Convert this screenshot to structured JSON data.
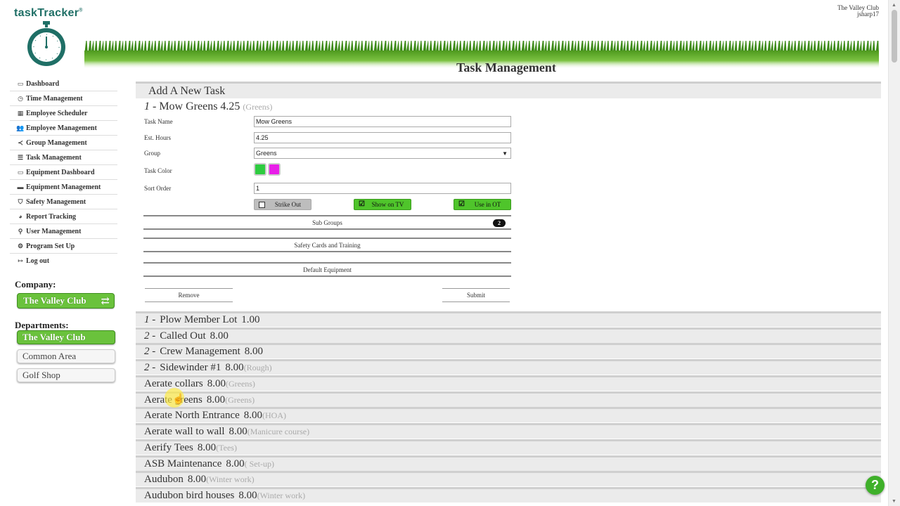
{
  "app": {
    "logo": "taskTracker",
    "logo_mark": "®"
  },
  "user": {
    "company": "The Valley Club",
    "username": "jsharp17"
  },
  "page_title": "Task Management",
  "nav": [
    {
      "label": "Dashboard",
      "icon": "monitor-icon",
      "glyph": "▭"
    },
    {
      "label": "Time Management",
      "icon": "clock-icon",
      "glyph": "◷"
    },
    {
      "label": "Employee Scheduler",
      "icon": "calendar-icon",
      "glyph": "▦"
    },
    {
      "label": "Employee Management",
      "icon": "users-icon",
      "glyph": "👥"
    },
    {
      "label": "Group Management",
      "icon": "share-icon",
      "glyph": "≺"
    },
    {
      "label": "Task Management",
      "icon": "list-icon",
      "glyph": "☰"
    },
    {
      "label": "Equipment Dashboard",
      "icon": "monitor-icon",
      "glyph": "▭"
    },
    {
      "label": "Equipment Management",
      "icon": "truck-icon",
      "glyph": "▬"
    },
    {
      "label": "Safety Management",
      "icon": "shield-icon",
      "glyph": "⛉"
    },
    {
      "label": "Report Tracking",
      "icon": "pie-chart-icon",
      "glyph": "◕"
    },
    {
      "label": "User Management",
      "icon": "user-plus-icon",
      "glyph": "⚲"
    },
    {
      "label": "Program Set Up",
      "icon": "gear-icon",
      "glyph": "⚙"
    },
    {
      "label": "Log out",
      "icon": "sign-out-icon",
      "glyph": "↦"
    }
  ],
  "company_section": {
    "label": "Company:",
    "button": "The Valley Club",
    "switch_glyph": "⇄"
  },
  "departments_section": {
    "label": "Departments:",
    "items": [
      "The Valley Club",
      "Common Area",
      "Golf Shop"
    ],
    "active_index": 0
  },
  "add_task_label": "Add A New Task",
  "editing_task": {
    "num": "1 -",
    "name": "Mow Greens",
    "hours": "4.25",
    "group": "(Greens)"
  },
  "form": {
    "task_name_label": "Task Name",
    "task_name_value": "Mow Greens",
    "est_hours_label": "Est. Hours",
    "est_hours_value": "4.25",
    "group_label": "Group",
    "group_value": "Greens",
    "task_color_label": "Task Color",
    "colors": [
      "#2ecc40",
      "#e81ee8"
    ],
    "sort_order_label": "Sort Order",
    "sort_order_value": "1",
    "toggles": {
      "strike_out": {
        "label": "Strike Out",
        "checked": false
      },
      "show_on_tv": {
        "label": "Show on TV",
        "checked": true
      },
      "use_in_ot": {
        "label": "Use in OT",
        "checked": true
      }
    },
    "sub_groups_label": "Sub Groups",
    "sub_groups_count": "2",
    "safety_label": "Safety Cards and Training",
    "equipment_label": "Default Equipment",
    "remove_label": "Remove",
    "submit_label": "Submit"
  },
  "tasks": [
    {
      "num": "1 -",
      "name": "Plow Member Lot",
      "hours": "1.00",
      "group": ""
    },
    {
      "num": "2 -",
      "name": "Called Out",
      "hours": "8.00",
      "group": ""
    },
    {
      "num": "2 -",
      "name": "Crew Management",
      "hours": "8.00",
      "group": ""
    },
    {
      "num": "2 -",
      "name": "Sidewinder #1",
      "hours": "8.00",
      "group": "(Rough)"
    },
    {
      "num": "",
      "name": "Aerate collars",
      "hours": "8.00",
      "group": "(Greens)"
    },
    {
      "num": "",
      "name": "Aerate greens",
      "hours": "8.00",
      "group": "(Greens)"
    },
    {
      "num": "",
      "name": "Aerate North Entrance",
      "hours": "8.00",
      "group": "(HOA)"
    },
    {
      "num": "",
      "name": "Aerate wall to wall",
      "hours": "8.00",
      "group": "(Manicure course)"
    },
    {
      "num": "",
      "name": "Aerify Tees",
      "hours": "8.00",
      "group": "(Tees)"
    },
    {
      "num": "",
      "name": "ASB Maintenance",
      "hours": "8.00",
      "group": "( Set-up)"
    },
    {
      "num": "",
      "name": "Audubon",
      "hours": "8.00",
      "group": "(Winter work)"
    },
    {
      "num": "",
      "name": "Audubon bird houses",
      "hours": "8.00",
      "group": "(Winter work)"
    }
  ],
  "help_label": "?",
  "colors": {
    "brand": "#1f6f66",
    "accent_green": "#6ac23c",
    "row_bg": "#ebebeb"
  }
}
